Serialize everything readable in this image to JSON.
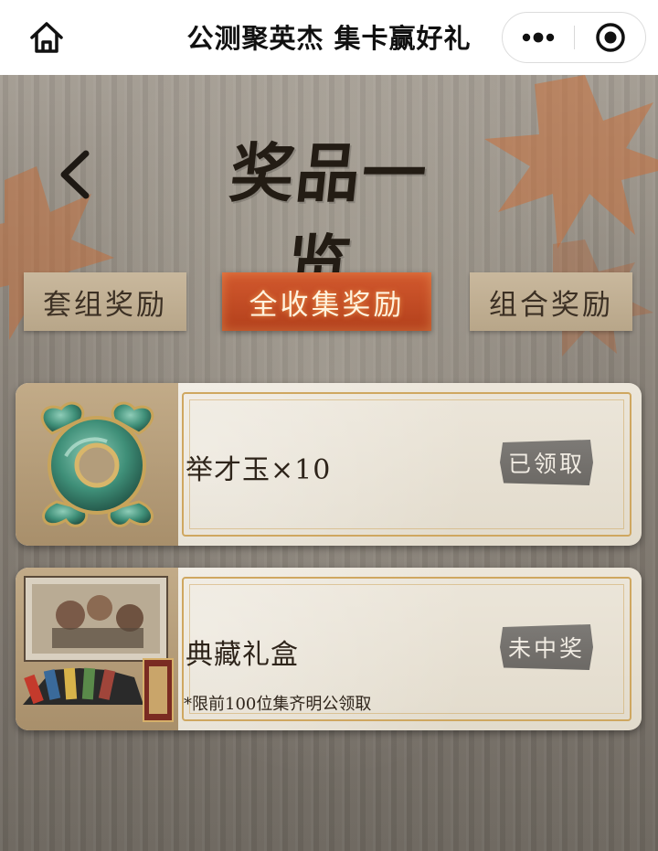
{
  "topbar": {
    "title": "公测聚英杰 集卡赢好礼",
    "home_icon": "home-icon",
    "more_icon": "more-dots-icon",
    "close_icon": "target-close-icon"
  },
  "heading": {
    "title": "奖品一览",
    "back_icon": "chevron-left-icon"
  },
  "tabs": [
    {
      "label": "套组奖励",
      "active": false
    },
    {
      "label": "全收集奖励",
      "active": true
    },
    {
      "label": "组合奖励",
      "active": false
    }
  ],
  "rewards": [
    {
      "name": "举才玉×10",
      "note": "",
      "status": "已领取",
      "thumb": "jade-ring-icon"
    },
    {
      "name": "典藏礼盒",
      "note": "*限前100位集齐明公领取",
      "status": "未中奖",
      "thumb": "gift-box-image"
    }
  ],
  "colors": {
    "active_tab": "#c44a22",
    "inactive_tab": "#c2b193",
    "card_border_gold": "#cfa760",
    "status_badge": "#74716d"
  }
}
